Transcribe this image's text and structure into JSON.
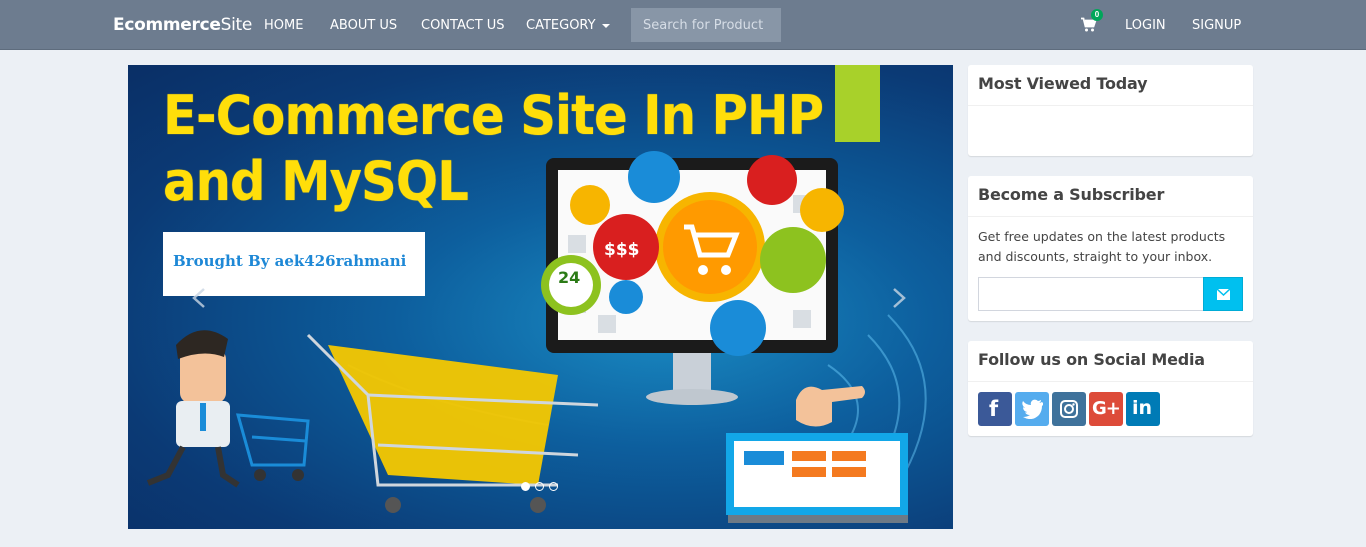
{
  "navbar": {
    "brand_bold": "Ecommerce",
    "brand_light": "Site",
    "home": "HOME",
    "about": "ABOUT US",
    "contact": "CONTACT US",
    "category": "CATEGORY",
    "search_placeholder": "Search for Product",
    "cart_count": "0",
    "login": "LOGIN",
    "signup": "SIGNUP",
    "cart_icon": "shopping-cart-icon"
  },
  "carousel": {
    "title_line1": "E-Commerce Site In PHP",
    "title_line2": "and MySQL",
    "brought_by": "Brought By aek426rahmani",
    "indicators": 3,
    "active_indicator": 1,
    "prev_icon": "chevron-left-icon",
    "next_icon": "chevron-right-icon",
    "accent_yellow": "#ffde0a",
    "accent_green": "#a8d12a"
  },
  "sidebar": {
    "most_viewed_title": "Most Viewed Today",
    "subscriber_title": "Become a Subscriber",
    "subscriber_text": "Get free updates on the latest products and discounts, straight to your inbox.",
    "subscribe_icon": "envelope-icon",
    "social_title": "Follow us on Social Media",
    "social": [
      {
        "name": "facebook",
        "icon": "facebook-icon",
        "color": "#3b5998",
        "glyph": "f"
      },
      {
        "name": "twitter",
        "icon": "twitter-icon",
        "color": "#55acee",
        "glyph": ""
      },
      {
        "name": "instagram",
        "icon": "instagram-icon",
        "color": "#3f729b",
        "glyph": ""
      },
      {
        "name": "google-plus",
        "icon": "google-plus-icon",
        "color": "#dd4b39",
        "glyph": "G+"
      },
      {
        "name": "linkedin",
        "icon": "linkedin-icon",
        "color": "#007bb6",
        "glyph": "in"
      }
    ]
  }
}
